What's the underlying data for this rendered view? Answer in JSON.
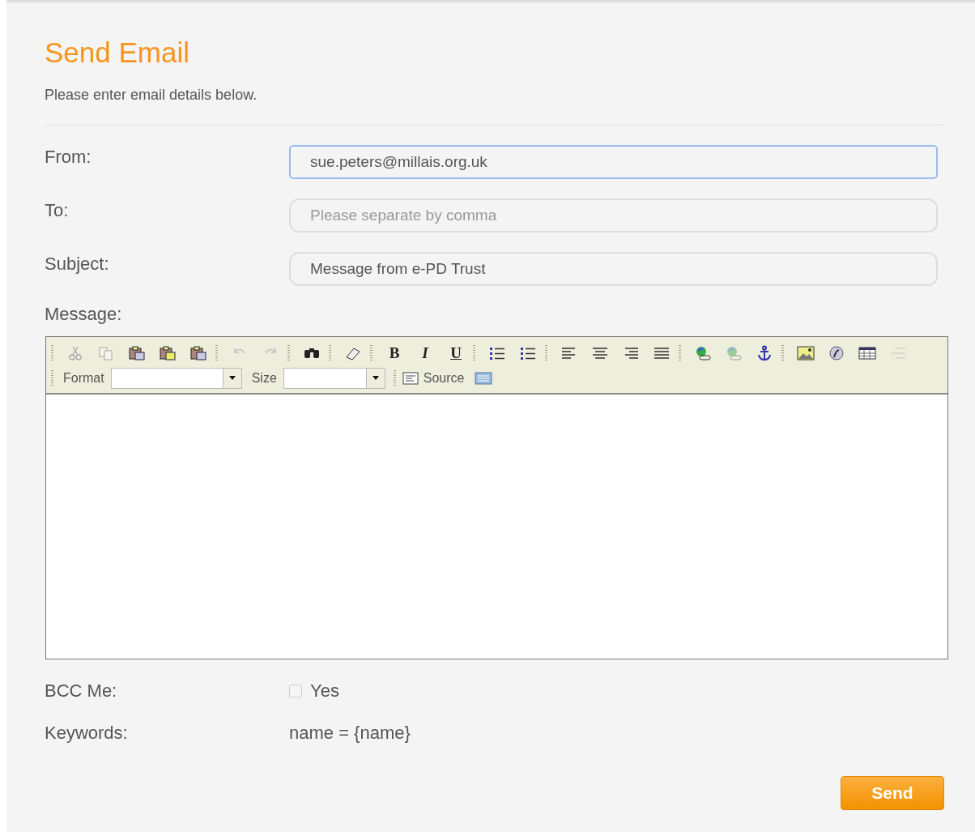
{
  "title": "Send Email",
  "intro": "Please enter email details below.",
  "fields": [
    {
      "label": "From:",
      "value": "sue.peters@millais.org.uk",
      "focused": true
    },
    {
      "label": "To:",
      "placeholder": "Please separate by comma",
      "focused": false
    },
    {
      "label": "Subject:",
      "value": "Message from e-PD Trust",
      "focused": false
    }
  ],
  "message": {
    "label": "Message:",
    "toolbar_groups": [
      [
        {
          "kind": "cut",
          "disabled": true
        },
        {
          "kind": "copy",
          "disabled": true
        },
        {
          "kind": "paste",
          "disabled": false
        },
        {
          "kind": "paste-text",
          "disabled": false
        },
        {
          "kind": "paste-word",
          "disabled": false
        }
      ],
      [
        {
          "kind": "undo",
          "disabled": true
        },
        {
          "kind": "redo",
          "disabled": true
        }
      ],
      [
        {
          "kind": "find",
          "disabled": false
        }
      ],
      [
        {
          "kind": "eraser",
          "disabled": false
        }
      ],
      [
        {
          "kind": "bold",
          "label": "B",
          "disabled": false
        },
        {
          "kind": "italic",
          "label": "I",
          "disabled": false
        },
        {
          "kind": "underline",
          "label": "U",
          "disabled": false
        }
      ],
      [
        {
          "kind": "ordered-list",
          "disabled": false
        },
        {
          "kind": "bullet-list",
          "disabled": false
        }
      ],
      [
        {
          "kind": "align-left",
          "disabled": false
        },
        {
          "kind": "align-center",
          "disabled": false
        },
        {
          "kind": "align-right",
          "disabled": false
        },
        {
          "kind": "justify",
          "disabled": false
        }
      ],
      [
        {
          "kind": "link",
          "disabled": false
        },
        {
          "kind": "link",
          "disabled": true
        },
        {
          "kind": "anchor",
          "disabled": false
        }
      ],
      [
        {
          "kind": "image",
          "disabled": false
        },
        {
          "kind": "flash",
          "disabled": false
        },
        {
          "kind": "table",
          "disabled": false
        },
        {
          "kind": "rule",
          "disabled": true
        }
      ]
    ],
    "format_label": "Format",
    "size_label": "Size",
    "source_label": "Source"
  },
  "bcc": {
    "label": "BCC Me:",
    "option": "Yes",
    "checked": false
  },
  "keywords": {
    "label": "Keywords:",
    "value": "name = {name}"
  },
  "send": "Send"
}
